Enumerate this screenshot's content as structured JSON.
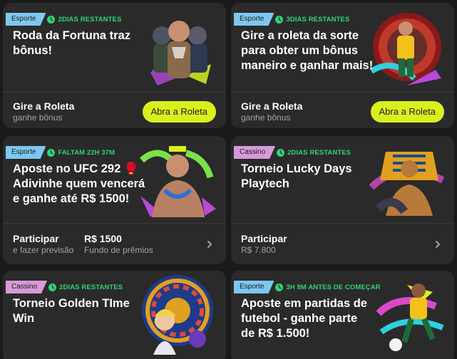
{
  "cards": [
    {
      "tag": "Esporte",
      "timer": "2DIAS RESTANTES",
      "title_lines": [
        "Roda da Fortuna traz",
        "bônus!"
      ],
      "footer_label": "Gire a Roleta",
      "footer_sub": "ganhe bônus",
      "button": "Abra a Roleta"
    },
    {
      "tag": "Esporte",
      "timer": "3DIAS RESTANTES",
      "title_lines": [
        "Gire a roleta da sorte",
        "para obter um bônus",
        "maneiro e ganhar mais!"
      ],
      "footer_label": "Gire a Roleta",
      "footer_sub": "ganhe bônus",
      "button": "Abra a Roleta"
    },
    {
      "tag": "Esporte",
      "timer": "FALTAM 22H 37M",
      "title_lines": [
        "Aposte no UFC 292 🥊",
        "Adivinhe quem vencerá",
        "e ganhe até R$ 1500!"
      ],
      "footer_label": "Participar",
      "footer_sub": "e fazer previsão",
      "prize_value": "R$ 1500",
      "prize_label": "Fundo de prêmios"
    },
    {
      "tag": "Cassino",
      "timer": "2DIAS RESTANTES",
      "title_lines": [
        "Torneio Lucky Days",
        "Playtech"
      ],
      "footer_label": "Participar",
      "footer_sub": "R$ 7.800"
    },
    {
      "tag": "Cassino",
      "timer": "2DIAS RESTANTES",
      "title_lines": [
        "Torneio Golden TIme",
        "Win"
      ]
    },
    {
      "tag": "Esporte",
      "timer": "3H 8M ANTES DE COMEÇAR",
      "title_lines": [
        "Aposte em partidas de",
        "futebol - ganhe parte",
        "de R$ 1.500!"
      ]
    }
  ],
  "colors": {
    "background": "#1a1a1a",
    "card": "#2a2a2a",
    "esporte_tag": "#7ec8f0",
    "cassino_tag": "#d79ad8",
    "timer_green": "#2fd47a",
    "button_lime": "#d9f01e"
  },
  "icons": {
    "timer": "clock-icon",
    "more": "chevron-right-icon"
  }
}
